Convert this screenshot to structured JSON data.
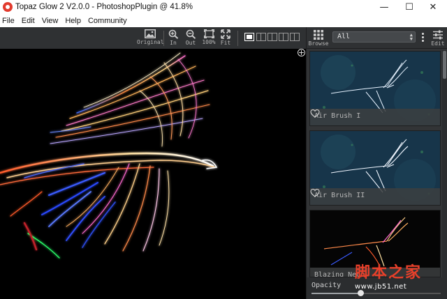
{
  "window": {
    "title": "Topaz Glow 2 V2.0.0 - PhotoshopPlugin @ 41.8%",
    "minimize": "—",
    "maximize": "☐",
    "close": "✕"
  },
  "menu": [
    "File",
    "Edit",
    "View",
    "Help",
    "Community"
  ],
  "toolbar": {
    "original": "Original",
    "zoom_in": "In",
    "zoom_out": "Out",
    "zoom_100": "100%",
    "fit": "Fit",
    "icons": [
      "image-icon",
      "zoom-in-icon",
      "zoom-out-icon",
      "actual-size-icon",
      "fit-icon"
    ],
    "view_modes": [
      "single-view",
      "split-vertical",
      "split-horizontal",
      "side-by-side",
      "top-bottom"
    ],
    "active_view_mode": "single-view"
  },
  "panel": {
    "browse": "Browse",
    "filter": "All",
    "edit": "Edit",
    "presets": [
      {
        "name": "Air Brush I"
      },
      {
        "name": "Air Brush II"
      },
      {
        "name": "Blazing Neon"
      }
    ],
    "opacity_label": "Opacity",
    "opacity_value": 0.38
  },
  "watermark": {
    "cn": "脚本之家",
    "url": "www.jb51.net"
  },
  "colors": {
    "titlebar": "#ffffff",
    "toolbar": "#2f3133",
    "panel": "#323436",
    "canvas": "#000000",
    "app_icon": "#e23b2e",
    "watermark": "#e8402a"
  }
}
